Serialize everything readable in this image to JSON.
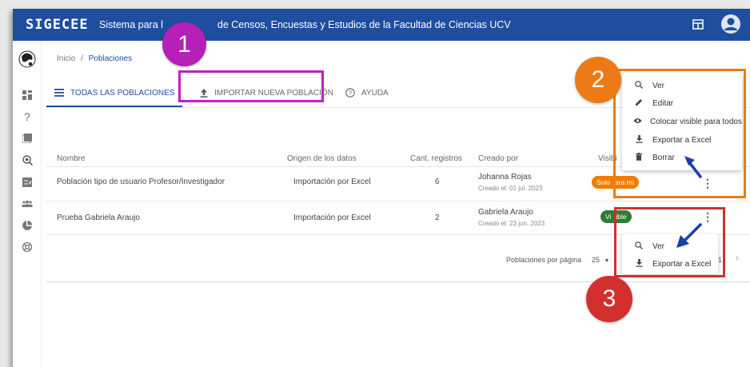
{
  "header": {
    "logo": "SIGECEE",
    "title": "Sistema para la Gestión de Censos, Encuestas y Estudios de la Facultad de Ciencias UCV",
    "title_visible_left": "Sistema para l",
    "title_visible_right": "de Censos, Encuestas y Estudios de la Facultad de Ciencias UCV",
    "bg_color": "#1f4e9e"
  },
  "breadcrumb": {
    "home": "Inicio",
    "sep": "/",
    "current": "Poblaciones"
  },
  "tabs": {
    "all": "TODAS LAS POBLACIONES",
    "import": "IMPORTAR NUEVA POBLACIÓN",
    "help": "AYUDA"
  },
  "table": {
    "columns": [
      "Nombre",
      "Origen de los datos",
      "Cant. registros",
      "Creado por",
      "Visibi"
    ],
    "rows": [
      {
        "name": "Población tipo de usuario Profesor/Investigador",
        "origin": "Importación por Excel",
        "count": "6",
        "creator": "Johanna Rojas",
        "created": "Creado el: 01 jul. 2023",
        "badge_left": "Solo",
        "badge_right": "ara mí",
        "badge_color": "#ef7d00"
      },
      {
        "name": "Prueba Gabriela Araujo",
        "origin": "Importación por Excel",
        "count": "2",
        "creator": "Gabriela Araujo",
        "created": "Creado el: 23 jun. 2023",
        "badge_left": "Vi",
        "badge_right": "ible",
        "badge_color": "#2e7d32"
      }
    ]
  },
  "pagination": {
    "label": "Poblaciones por página",
    "per_page": "25",
    "page": "1"
  },
  "menu_full": {
    "items": [
      {
        "icon": "search-icon",
        "label": "Ver"
      },
      {
        "icon": "pencil-icon",
        "label": "Editar"
      },
      {
        "icon": "eye-icon",
        "label": "Colocar visible para todos"
      },
      {
        "icon": "download-icon",
        "label": "Exportar a Excel"
      },
      {
        "icon": "trash-icon",
        "label": "Borrar"
      }
    ]
  },
  "menu_small": {
    "items": [
      {
        "icon": "search-icon",
        "label": "Ver"
      },
      {
        "icon": "download-icon",
        "label": "Exportar a Excel"
      }
    ]
  },
  "annotations": {
    "one": {
      "label": "1",
      "color": "#b61fb8",
      "box_color": "#c21fc4"
    },
    "two": {
      "label": "2",
      "color": "#ec7b15",
      "box_color": "#ec7b15"
    },
    "three": {
      "label": "3",
      "color": "#d32f2f",
      "box_color": "#d32f2f"
    }
  }
}
